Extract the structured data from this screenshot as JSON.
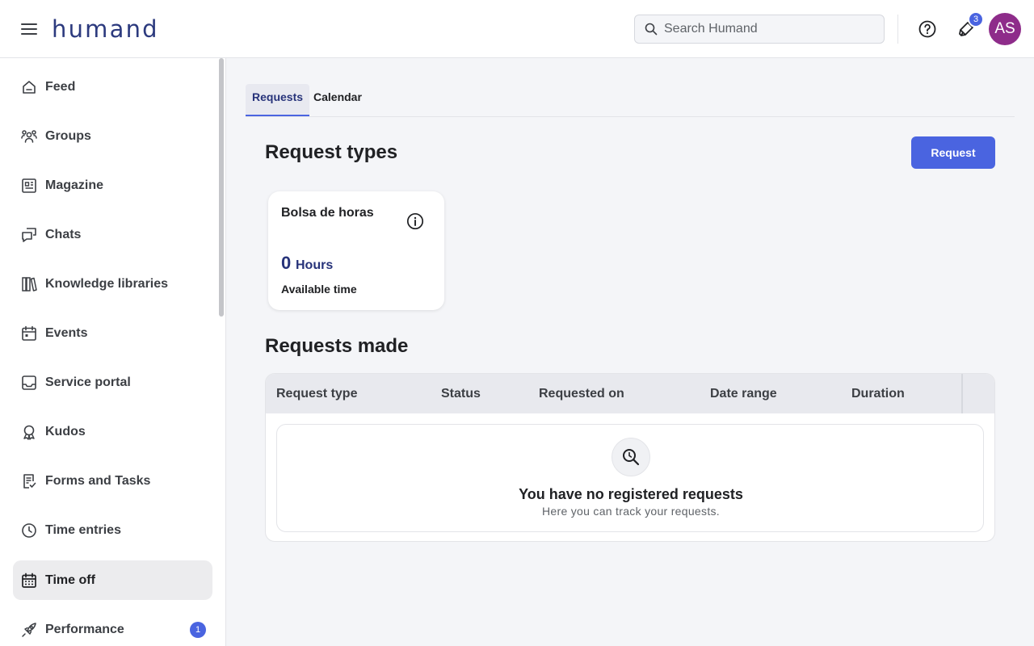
{
  "header": {
    "logo": "humand",
    "search_placeholder": "Search Humand",
    "notifications_count": "3",
    "avatar_initials": "AS"
  },
  "sidebar": {
    "items": [
      {
        "label": "Feed",
        "icon": "home-icon"
      },
      {
        "label": "Groups",
        "icon": "groups-icon"
      },
      {
        "label": "Magazine",
        "icon": "magazine-icon"
      },
      {
        "label": "Chats",
        "icon": "chat-icon"
      },
      {
        "label": "Knowledge libraries",
        "icon": "library-icon"
      },
      {
        "label": "Events",
        "icon": "calendar-icon"
      },
      {
        "label": "Service portal",
        "icon": "inbox-icon"
      },
      {
        "label": "Kudos",
        "icon": "award-icon"
      },
      {
        "label": "Forms and Tasks",
        "icon": "form-check-icon"
      },
      {
        "label": "Time entries",
        "icon": "clock-icon"
      },
      {
        "label": "Time off",
        "icon": "calendar-grid-icon",
        "active": true
      },
      {
        "label": "Performance",
        "icon": "rocket-icon",
        "badge": "1"
      }
    ]
  },
  "tabs": [
    {
      "label": "Requests",
      "active": true
    },
    {
      "label": "Calendar",
      "active": false
    }
  ],
  "request_types": {
    "title": "Request types",
    "button": "Request",
    "cards": [
      {
        "title": "Bolsa de horas",
        "value": "0",
        "unit": "Hours",
        "subtitle": "Available time"
      }
    ]
  },
  "requests_made": {
    "title": "Requests made",
    "columns": [
      "Request type",
      "Status",
      "Requested on",
      "Date range",
      "Duration"
    ],
    "empty_title": "You have no registered requests",
    "empty_subtitle": "Here you can track your requests."
  },
  "colors": {
    "accent": "#4a64e0",
    "brand_dark": "#27337a",
    "avatar": "#8e2c8a"
  }
}
